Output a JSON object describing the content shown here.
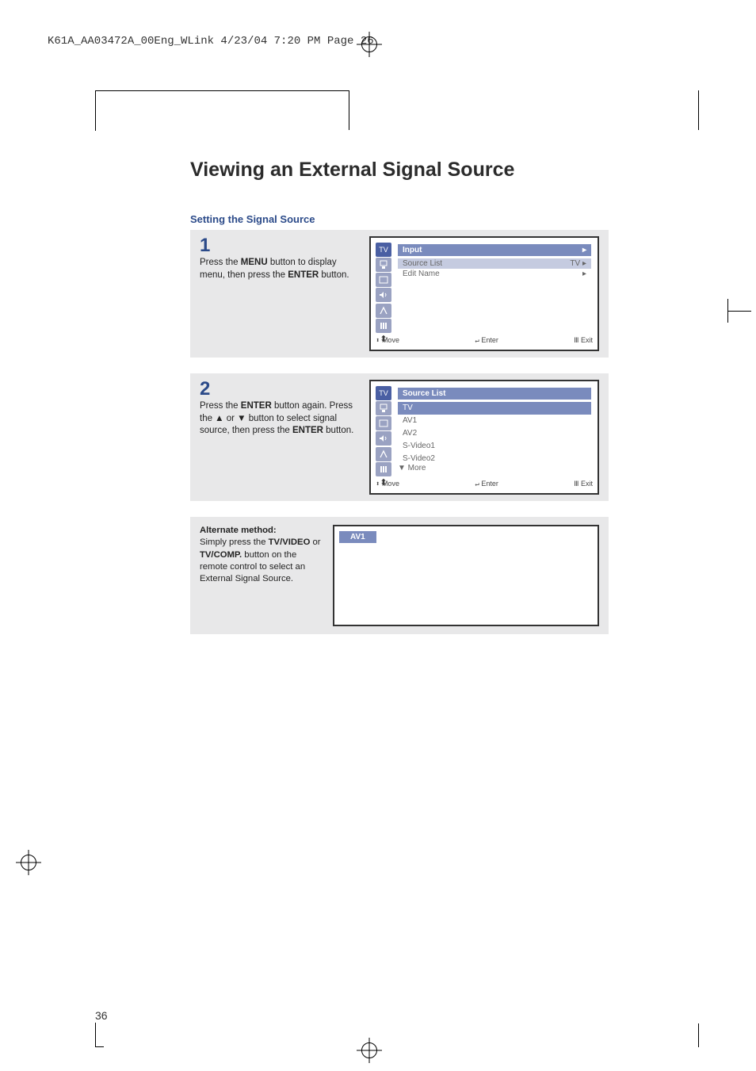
{
  "header_line": "K61A_AA03472A_00Eng_WLink  4/23/04  7:20 PM  Page 26",
  "title": "Viewing an External Signal Source",
  "subtitle": "Setting the Signal Source",
  "step1": {
    "num": "1",
    "text_part1": "Press the ",
    "text_bold1": "MENU",
    "text_part2": " button to display menu, then press the ",
    "text_bold2": "ENTER",
    "text_part3": " button."
  },
  "step2": {
    "num": "2",
    "text_part1": "Press the ",
    "text_bold1": "ENTER",
    "text_part2": " button again. Press the ▲ or ▼ button to select signal source, then press the ",
    "text_bold2": "ENTER",
    "text_part3": " button."
  },
  "alt": {
    "heading": "Alternate method:",
    "line1a": "Simply press the ",
    "line1b": "TV/VIDEO",
    "line2a": " or ",
    "line2b": "TV/COMP.",
    "line2c": " button on the remote control to select an External Signal Source."
  },
  "osd1": {
    "title_left": "Input",
    "row1_l": "Source List",
    "row1_r": "TV",
    "row2_l": "Edit Name",
    "footer_move": "Move",
    "footer_enter": "Enter",
    "footer_exit": "Exit"
  },
  "osd2": {
    "title_left": "Source List",
    "options": [
      "TV",
      "AV1",
      "AV2",
      "S-Video1",
      "S-Video2"
    ],
    "more": "▼ More",
    "footer_move": "Move",
    "footer_enter": "Enter",
    "footer_exit": "Exit"
  },
  "tv_badge": "AV1",
  "page_number": "36"
}
